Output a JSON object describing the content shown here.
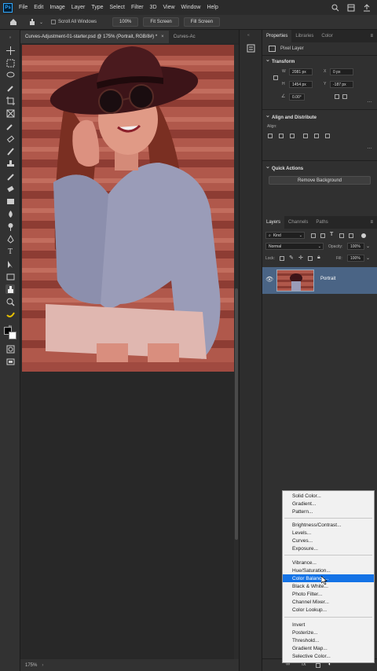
{
  "menubar": {
    "logo": "Ps",
    "items": [
      "File",
      "Edit",
      "Image",
      "Layer",
      "Type",
      "Select",
      "Filter",
      "3D",
      "View",
      "Window",
      "Help"
    ]
  },
  "options": {
    "scroll_all": "Scroll All Windows",
    "zoom": "100%",
    "fit_screen": "Fit Screen",
    "fill_screen": "Fill Screen"
  },
  "tabs": [
    {
      "label": "Curves-Adjustment-01-starter.psd @ 175% (Portrait, RGB/8#) *"
    },
    {
      "label": "Curves-Ac"
    }
  ],
  "status": {
    "zoom": "175%"
  },
  "properties": {
    "tabs": [
      "Properties",
      "Libraries",
      "Color"
    ],
    "layer_type": "Pixel Layer",
    "transform_title": "Transform",
    "w_label": "W",
    "w_value": "2081 px",
    "h_label": "H",
    "h_value": "1454 px",
    "x_label": "X",
    "x_value": "0 px",
    "y_label": "Y",
    "y_value": "-187 px",
    "angle_value": "0.00°",
    "align_title": "Align and Distribute",
    "align_label": "Align:",
    "quick_title": "Quick Actions",
    "remove_bg": "Remove Background"
  },
  "layers": {
    "tabs": [
      "Layers",
      "Channels",
      "Paths"
    ],
    "kind": "Kind",
    "blend_mode": "Normal",
    "opacity_label": "Opacity:",
    "opacity_value": "100%",
    "lock_label": "Lock:",
    "fill_label": "Fill:",
    "fill_value": "100%",
    "layer_name": "Portrait"
  },
  "adjustment_menu": {
    "group1": [
      "Solid Color...",
      "Gradient...",
      "Pattern..."
    ],
    "group2": [
      "Brightness/Contrast...",
      "Levels...",
      "Curves...",
      "Exposure..."
    ],
    "group3": [
      "Vibrance...",
      "Hue/Saturation...",
      "Color Balance...",
      "Black & White...",
      "Photo Filter...",
      "Channel Mixer...",
      "Color Lookup..."
    ],
    "group4": [
      "Invert",
      "Posterize...",
      "Threshold...",
      "Gradient Map...",
      "Selective Color..."
    ],
    "highlighted": "Color Balance..."
  },
  "colors": {
    "accent": "#1473e6",
    "layer_selected": "#4a6485"
  }
}
